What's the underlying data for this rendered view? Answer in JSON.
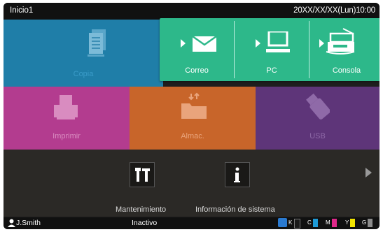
{
  "header": {
    "title": "Inicio1",
    "datetime": "20XX/XX/XX(Lun)10:00"
  },
  "tiles": {
    "copy": {
      "label": "Copia"
    },
    "email": {
      "label": "Correo"
    },
    "pc": {
      "label": "PC"
    },
    "console": {
      "label": "Consola"
    },
    "print": {
      "label": "Imprimir"
    },
    "storage": {
      "label": "Almac."
    },
    "usb": {
      "label": "USB"
    }
  },
  "bottom": {
    "maintenance": {
      "label": "Mantenimiento"
    },
    "system_info": {
      "label": "Información de sistema"
    }
  },
  "status": {
    "user": "J.Smith",
    "state": "Inactivo",
    "toner": [
      {
        "letter": "K",
        "color": "#1a1a1a"
      },
      {
        "letter": "C",
        "color": "#1e9ad6"
      },
      {
        "letter": "M",
        "color": "#e0288a"
      },
      {
        "letter": "Y",
        "color": "#f1e300"
      },
      {
        "letter": "G",
        "color": "#8a8a8a"
      }
    ]
  },
  "colors": {
    "copy": "#1f7ea8",
    "email_panel": "#2db88a",
    "print": "#b33c8f",
    "storage": "#c8652a",
    "usb": "#5e3579"
  }
}
